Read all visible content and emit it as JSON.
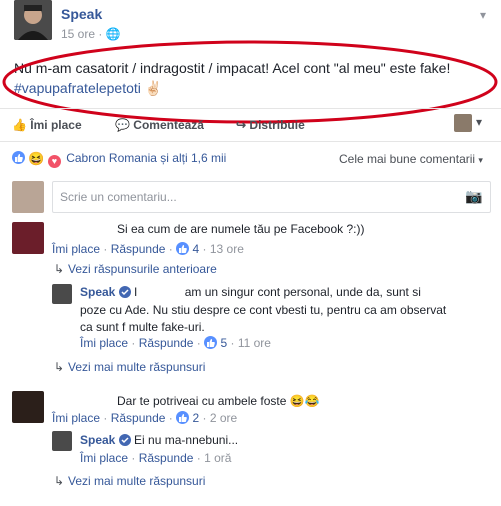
{
  "post": {
    "author": "Speak",
    "time": "15 ore",
    "text": "Nu m-am casatorit / indragostit / impacat! Acel cont \"al meu\" este fake!",
    "hashtag": "#vapupafratelepetoti",
    "emoji": "✌🏻"
  },
  "actions": {
    "like": "Îmi place",
    "comment": "Comentează",
    "share": "Distribuie"
  },
  "reactions": {
    "summary": "Cabron Romania și alți 1,6 mii",
    "sort": "Cele mai bune comentarii"
  },
  "comment_box": {
    "placeholder": "Scrie un comentariu..."
  },
  "comments": [
    {
      "text": "Si ea cum de are numele tău pe Facebook ?:))",
      "like": "Îmi place",
      "reply": "Răspunde",
      "likes": "4",
      "time": "13 ore",
      "previous_replies": "Vezi răspunsurile anterioare",
      "reply_author": "Speak",
      "reply_initial": "I",
      "reply_text_line1": "am un singur cont personal, unde da, sunt si",
      "reply_text_line2": "poze cu Ade. Nu stiu despre ce cont vbesti tu, pentru ca am observat",
      "reply_text_line3": "ca sunt f multe fake-uri.",
      "reply_like": "Îmi place",
      "reply_reply": "Răspunde",
      "reply_likes": "5",
      "reply_time": "11 ore",
      "more_replies": "Vezi mai multe răspunsuri"
    },
    {
      "text": "Dar te potriveai cu ambele foste",
      "like": "Îmi place",
      "reply": "Răspunde",
      "likes": "2",
      "time": "2 ore",
      "reply_author": "Speak",
      "reply_text": "Ei nu ma-nnebuni...",
      "reply_like": "Îmi place",
      "reply_reply": "Răspunde",
      "reply_time": "1 oră",
      "more_replies": "Vezi mai multe răspunsuri"
    }
  ],
  "colors": {
    "link": "#365899",
    "muted": "#90949c",
    "annotation": "#d0021b"
  }
}
